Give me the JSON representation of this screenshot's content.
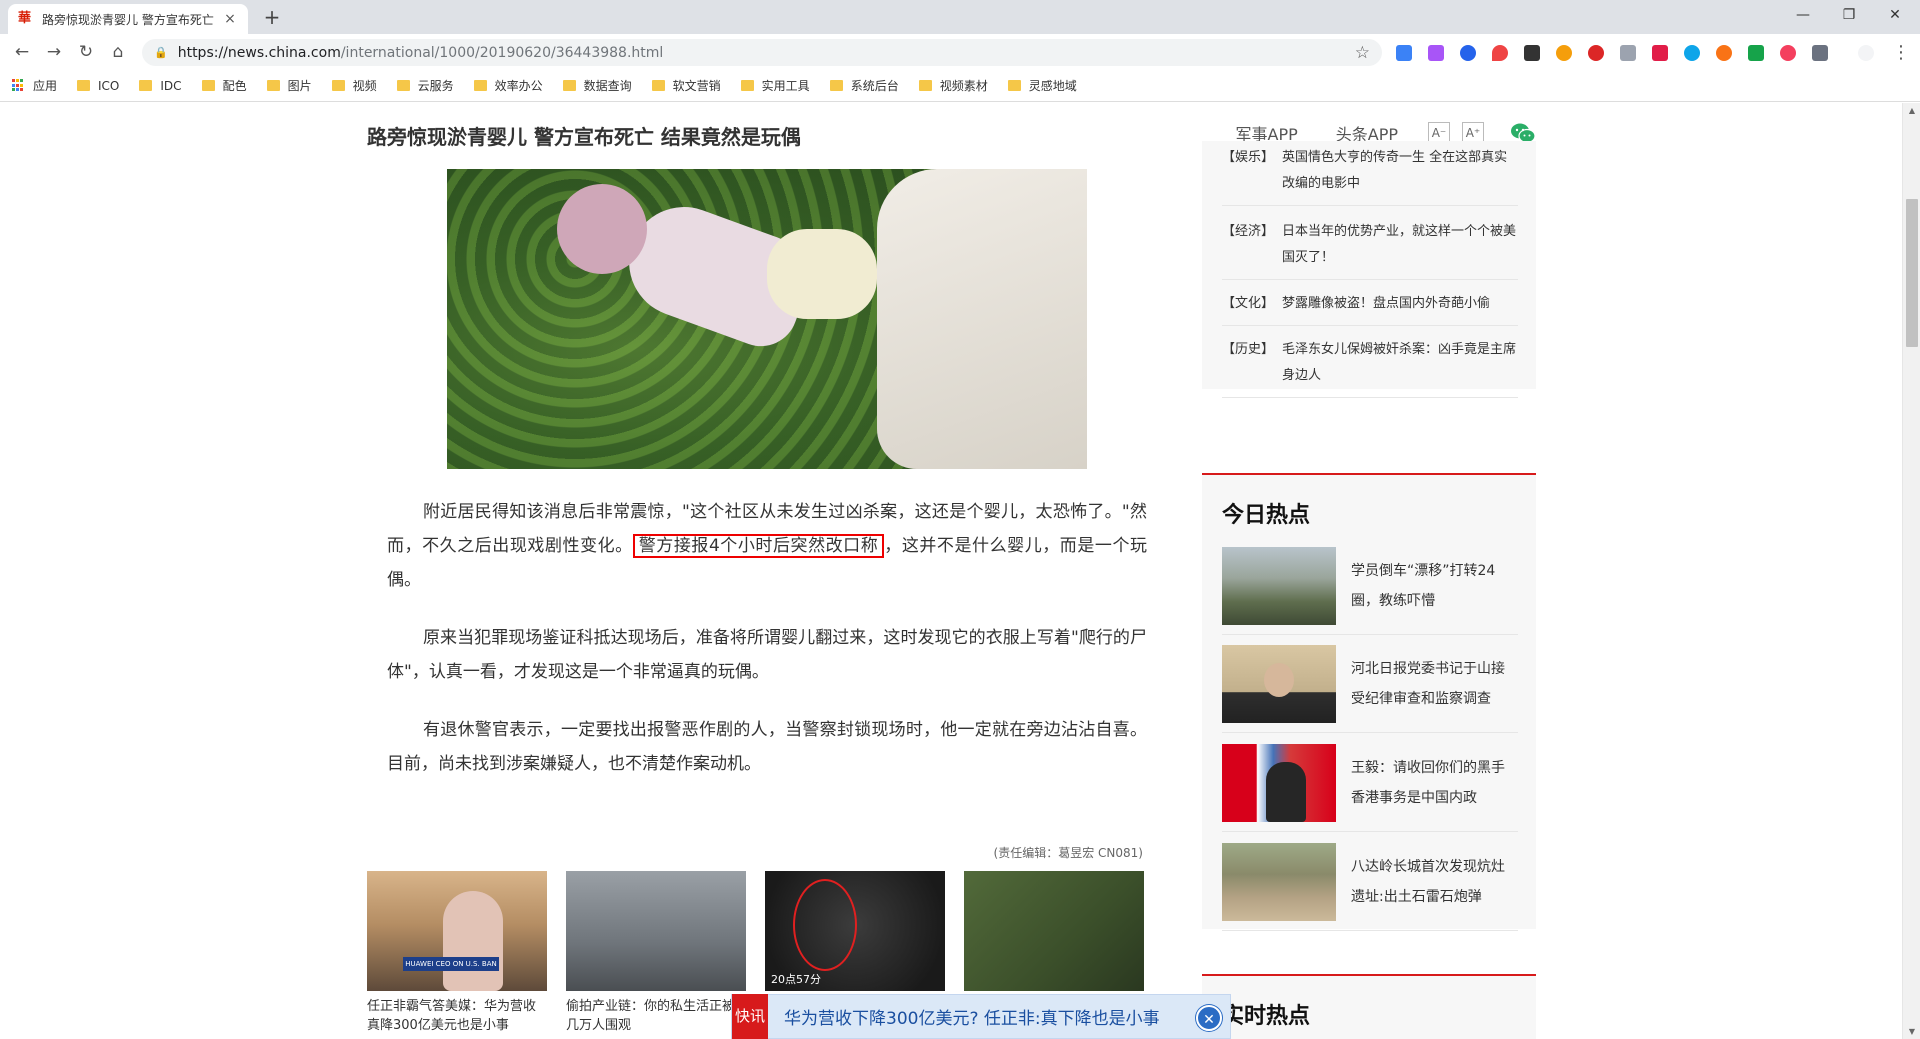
{
  "browser": {
    "tab_title": "路旁惊现淤青婴儿 警方宣布死亡",
    "tab_close": "×",
    "new_tab": "+",
    "window_controls": [
      "—",
      "❐",
      "✕"
    ],
    "url_host": "https://news.china.com",
    "url_path": "/international/1000/20190620/36443988.html",
    "bookmarks": [
      "应用",
      "ICO",
      "IDC",
      "配色",
      "图片",
      "视频",
      "云服务",
      "效率办公",
      "数据查询",
      "软文营销",
      "实用工具",
      "系统后台",
      "视频素材",
      "灵感地域"
    ]
  },
  "header": {
    "title": "路旁惊现淤青婴儿 警方宣布死亡 结果竟然是玩偶",
    "links": [
      "军事APP",
      "头条APP"
    ],
    "font_small": "A⁻",
    "font_large": "A⁺"
  },
  "article": {
    "p1_before": "附近居民得知该消息后非常震惊，\"这个社区从未发生过凶杀案，这还是个婴儿，太恐怖了。\"然而，不久之后出现戏剧性变化。",
    "p1_highlight": "警方接报4个小时后突然改口称",
    "p1_after": "，这并不是什么婴儿，而是一个玩偶。",
    "p2": "原来当犯罪现场鉴证科抵达现场后，准备将所谓婴儿翻过来，这时发现它的衣服上写着\"爬行的尸体\"，认真一看，才发现这是一个非常逼真的玩偶。",
    "p3": "有退休警官表示，一定要找出报警恶作剧的人，当警察封锁现场时，他一定就在旁边沾沾自喜。目前，尚未找到涉案嫌疑人，也不清楚作案动机。",
    "editor": "(责任编辑：葛昱宏 CN081)"
  },
  "related": [
    {
      "caption": "任正非霸气答美媒：华为营收真降300亿美元也是小事",
      "banner": "HUAWEI CEO ON U.S. BAN"
    },
    {
      "caption": "偷拍产业链：你的私生活正被几万人围观",
      "banner": ""
    },
    {
      "caption": "",
      "banner": "",
      "time": "20点57分"
    },
    {
      "caption": "",
      "banner": ""
    }
  ],
  "sidebar": {
    "top_news": [
      {
        "tag": "【娱乐】",
        "title": "英国情色大亨的传奇一生 全在这部真实改编的电影中"
      },
      {
        "tag": "【经济】",
        "title": "日本当年的优势产业，就这样一个个被美国灭了！"
      },
      {
        "tag": "【文化】",
        "title": "梦露雕像被盗！盘点国内外奇葩小偷"
      },
      {
        "tag": "【历史】",
        "title": "毛泽东女儿保姆被奸杀案：凶手竟是主席身边人"
      }
    ],
    "hot_title": "今日热点",
    "hot_items": [
      {
        "title": "学员倒车“漂移”打转24圈，教练吓懵"
      },
      {
        "title": "河北日报党委书记于山接受纪律审查和监察调查"
      },
      {
        "title": "王毅：请收回你们的黑手 香港事务是中国内政"
      },
      {
        "title": "八达岭长城首次发现炕灶遗址:出土石雷石炮弹"
      }
    ],
    "realtime_title": "实时热点"
  },
  "popup": {
    "badge": "快讯",
    "text": "华为营收下降300亿美元? 任正非:真下降也是小事",
    "close": "✕"
  },
  "colors": {
    "accent_red": "#d71a1b",
    "popup_blue": "#1a4fa0"
  }
}
